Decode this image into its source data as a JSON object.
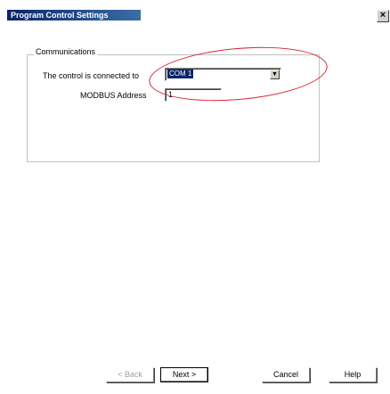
{
  "window": {
    "title": "Program Control Settings",
    "close_symbol": "×"
  },
  "communications": {
    "group_label": "Communications",
    "connected_label": "The control is connected to",
    "port_value": "COM 1",
    "dropdown_symbol": "▼",
    "modbus_label": "MODBUS Address",
    "modbus_value": "1"
  },
  "buttons": {
    "back": "< Back",
    "next": "Next >",
    "cancel": "Cancel",
    "help": "Help"
  },
  "colors": {
    "titlebar": "#0a246a",
    "annotation": "#d9263a",
    "selection": "#0a246a"
  }
}
